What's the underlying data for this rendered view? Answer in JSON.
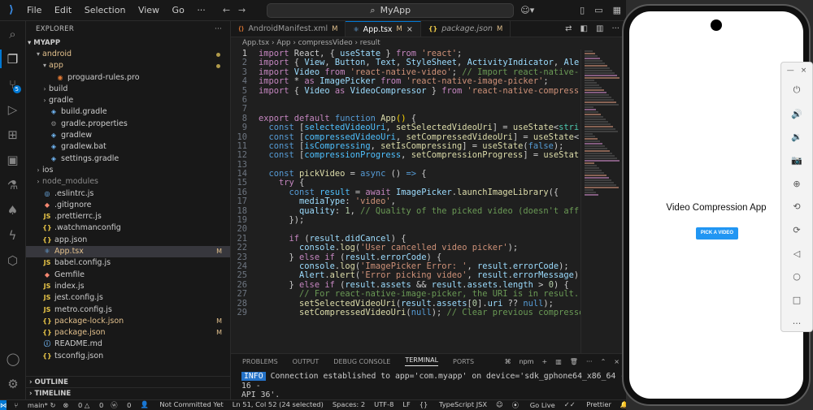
{
  "titlebar": {
    "menu": [
      "File",
      "Edit",
      "Selection",
      "View",
      "Go"
    ],
    "search": "MyApp"
  },
  "explorer": {
    "header": "EXPLORER",
    "project": "MYAPP",
    "items": [
      {
        "label": "android",
        "type": "folder",
        "open": true,
        "indent": 1,
        "color": "mod",
        "dot": true
      },
      {
        "label": "app",
        "type": "folder",
        "open": true,
        "indent": 2,
        "color": "mod",
        "dot": true
      },
      {
        "label": "proguard-rules.pro",
        "type": "file",
        "indent": 3,
        "color": "plain",
        "icon": "pro-file-icon"
      },
      {
        "label": "build",
        "type": "folder",
        "open": false,
        "indent": 2,
        "color": "plain"
      },
      {
        "label": "gradle",
        "type": "folder",
        "open": false,
        "indent": 2,
        "color": "plain"
      },
      {
        "label": "build.gradle",
        "type": "file",
        "indent": 2,
        "color": "plain",
        "icon": "gradle-icon"
      },
      {
        "label": "gradle.properties",
        "type": "file",
        "indent": 2,
        "color": "plain",
        "icon": "gear-icon"
      },
      {
        "label": "gradlew",
        "type": "file",
        "indent": 2,
        "color": "plain",
        "icon": "gradle-icon"
      },
      {
        "label": "gradlew.bat",
        "type": "file",
        "indent": 2,
        "color": "plain",
        "icon": "gradle-icon"
      },
      {
        "label": "settings.gradle",
        "type": "file",
        "indent": 2,
        "color": "plain",
        "icon": "gradle-icon"
      },
      {
        "label": "ios",
        "type": "folder",
        "open": false,
        "indent": 1,
        "color": "plain"
      },
      {
        "label": "node_modules",
        "type": "folder",
        "open": false,
        "indent": 1,
        "color": "gray"
      },
      {
        "label": ".eslintrc.js",
        "type": "file",
        "indent": 1,
        "color": "plain",
        "icon": "eslint-icon"
      },
      {
        "label": ".gitignore",
        "type": "file",
        "indent": 1,
        "color": "plain",
        "icon": "git-icon"
      },
      {
        "label": ".prettierrc.js",
        "type": "file",
        "indent": 1,
        "color": "plain",
        "icon": "js-icon"
      },
      {
        "label": ".watchmanconfig",
        "type": "file",
        "indent": 1,
        "color": "plain",
        "icon": "json-icon"
      },
      {
        "label": "app.json",
        "type": "file",
        "indent": 1,
        "color": "plain",
        "icon": "json-icon"
      },
      {
        "label": "App.tsx",
        "type": "file",
        "indent": 1,
        "color": "mod",
        "icon": "react-icon",
        "status": "M",
        "selected": true
      },
      {
        "label": "babel.config.js",
        "type": "file",
        "indent": 1,
        "color": "plain",
        "icon": "js-icon"
      },
      {
        "label": "Gemfile",
        "type": "file",
        "indent": 1,
        "color": "plain",
        "icon": "ruby-icon"
      },
      {
        "label": "index.js",
        "type": "file",
        "indent": 1,
        "color": "plain",
        "icon": "js-icon"
      },
      {
        "label": "jest.config.js",
        "type": "file",
        "indent": 1,
        "color": "plain",
        "icon": "js-icon"
      },
      {
        "label": "metro.config.js",
        "type": "file",
        "indent": 1,
        "color": "plain",
        "icon": "js-icon"
      },
      {
        "label": "package-lock.json",
        "type": "file",
        "indent": 1,
        "color": "mod",
        "icon": "json-icon",
        "status": "M"
      },
      {
        "label": "package.json",
        "type": "file",
        "indent": 1,
        "color": "mod",
        "icon": "json-icon",
        "status": "M"
      },
      {
        "label": "README.md",
        "type": "file",
        "indent": 1,
        "color": "plain",
        "icon": "info-icon"
      },
      {
        "label": "tsconfig.json",
        "type": "file",
        "indent": 1,
        "color": "plain",
        "icon": "json-icon"
      }
    ],
    "outline": "OUTLINE",
    "timeline": "TIMELINE"
  },
  "tabs": [
    {
      "label": "AndroidManifest.xml",
      "status": "M",
      "active": false,
      "icon": "xml-icon"
    },
    {
      "label": "App.tsx",
      "status": "M",
      "active": true,
      "icon": "react-icon"
    },
    {
      "label": "package.json",
      "status": "M",
      "active": false,
      "icon": "json-icon"
    }
  ],
  "breadcrumb": "App.tsx  ›  App  ›  compressVideo  ›  result",
  "code": {
    "current_line": 1,
    "lines": [
      [
        [
          "kw",
          "import"
        ],
        [
          "txt",
          " React, { "
        ],
        [
          "id",
          "useState"
        ],
        [
          "txt",
          " } "
        ],
        [
          "kw",
          "from"
        ],
        [
          "str",
          " 'react'"
        ],
        [
          "txt",
          ";"
        ]
      ],
      [
        [
          "kw",
          "import"
        ],
        [
          "txt",
          " { "
        ],
        [
          "id",
          "View"
        ],
        [
          "txt",
          ", "
        ],
        [
          "id",
          "Button"
        ],
        [
          "txt",
          ", "
        ],
        [
          "id",
          "Text"
        ],
        [
          "txt",
          ", "
        ],
        [
          "id",
          "StyleSheet"
        ],
        [
          "txt",
          ", "
        ],
        [
          "id",
          "ActivityIndicator"
        ],
        [
          "txt",
          ", "
        ],
        [
          "id",
          "Ale"
        ]
      ],
      [
        [
          "kw",
          "import"
        ],
        [
          "id",
          " Video"
        ],
        [
          "kw",
          " from"
        ],
        [
          "str",
          " 'react-native-video'"
        ],
        [
          "txt",
          "; "
        ],
        [
          "cm",
          "// Import react-native-"
        ]
      ],
      [
        [
          "kw",
          "import"
        ],
        [
          "txt",
          " * "
        ],
        [
          "kw",
          "as"
        ],
        [
          "id",
          " ImagePicker"
        ],
        [
          "kw",
          " from"
        ],
        [
          "str",
          " 'react-native-image-picker'"
        ],
        [
          "txt",
          ";"
        ]
      ],
      [
        [
          "kw",
          "import"
        ],
        [
          "txt",
          " { "
        ],
        [
          "id",
          "Video"
        ],
        [
          "kw",
          " as"
        ],
        [
          "id",
          " VideoCompressor"
        ],
        [
          "txt",
          " } "
        ],
        [
          "kw",
          "from"
        ],
        [
          "str",
          " 'react-native-compress"
        ]
      ],
      [],
      [],
      [
        [
          "kw",
          "export default"
        ],
        [
          "kw2",
          " function"
        ],
        [
          "fn",
          " App"
        ],
        [
          "pn",
          "()"
        ],
        [
          "txt",
          " {"
        ]
      ],
      [
        [
          "txt",
          "  "
        ],
        [
          "kw2",
          "const"
        ],
        [
          "txt",
          " ["
        ],
        [
          "cst",
          "selectedVideoUri"
        ],
        [
          "txt",
          ", "
        ],
        [
          "fn",
          "setSelectedVideoUri"
        ],
        [
          "txt",
          "] = "
        ],
        [
          "fn",
          "useState"
        ],
        [
          "txt",
          "<"
        ],
        [
          "cls",
          "stri"
        ]
      ],
      [
        [
          "txt",
          "  "
        ],
        [
          "kw2",
          "const"
        ],
        [
          "txt",
          " ["
        ],
        [
          "cst",
          "compressedVideoUri"
        ],
        [
          "txt",
          ", "
        ],
        [
          "fn",
          "setCompressedVideoUri"
        ],
        [
          "txt",
          "] = "
        ],
        [
          "fn",
          "useState"
        ],
        [
          "txt",
          "<"
        ]
      ],
      [
        [
          "txt",
          "  "
        ],
        [
          "kw2",
          "const"
        ],
        [
          "txt",
          " ["
        ],
        [
          "cst",
          "isCompressing"
        ],
        [
          "txt",
          ", "
        ],
        [
          "fn",
          "setIsCompressing"
        ],
        [
          "txt",
          "] = "
        ],
        [
          "fn",
          "useState"
        ],
        [
          "txt",
          "("
        ],
        [
          "kw2",
          "false"
        ],
        [
          "txt",
          ");"
        ]
      ],
      [
        [
          "txt",
          "  "
        ],
        [
          "kw2",
          "const"
        ],
        [
          "txt",
          " ["
        ],
        [
          "cst",
          "compressionProgress"
        ],
        [
          "txt",
          ", "
        ],
        [
          "fn",
          "setCompressionProgress"
        ],
        [
          "txt",
          "] = "
        ],
        [
          "fn",
          "useStat"
        ]
      ],
      [],
      [
        [
          "txt",
          "  "
        ],
        [
          "kw2",
          "const"
        ],
        [
          "fn",
          " pickVideo"
        ],
        [
          "txt",
          " = "
        ],
        [
          "kw2",
          "async"
        ],
        [
          "txt",
          " () "
        ],
        [
          "kw2",
          "=>"
        ],
        [
          "txt",
          " {"
        ]
      ],
      [
        [
          "txt",
          "    "
        ],
        [
          "kw",
          "try"
        ],
        [
          "txt",
          " {"
        ]
      ],
      [
        [
          "txt",
          "      "
        ],
        [
          "kw2",
          "const"
        ],
        [
          "cst",
          " result"
        ],
        [
          "txt",
          " = "
        ],
        [
          "kw",
          "await"
        ],
        [
          "id",
          " ImagePicker"
        ],
        [
          "txt",
          "."
        ],
        [
          "fn",
          "launchImageLibrary"
        ],
        [
          "txt",
          "({"
        ]
      ],
      [
        [
          "txt",
          "        "
        ],
        [
          "id",
          "mediaType"
        ],
        [
          "txt",
          ": "
        ],
        [
          "str",
          "'video'"
        ],
        [
          "txt",
          ","
        ]
      ],
      [
        [
          "txt",
          "        "
        ],
        [
          "id",
          "quality"
        ],
        [
          "txt",
          ": "
        ],
        [
          "num",
          "1"
        ],
        [
          "txt",
          ", "
        ],
        [
          "cm",
          "// Quality of the picked video (doesn't aff"
        ]
      ],
      [
        [
          "txt",
          "      });"
        ]
      ],
      [],
      [
        [
          "txt",
          "      "
        ],
        [
          "kw",
          "if"
        ],
        [
          "txt",
          " ("
        ],
        [
          "id",
          "result"
        ],
        [
          "txt",
          "."
        ],
        [
          "id",
          "didCancel"
        ],
        [
          "txt",
          ") {"
        ]
      ],
      [
        [
          "txt",
          "        "
        ],
        [
          "id",
          "console"
        ],
        [
          "txt",
          "."
        ],
        [
          "fn",
          "log"
        ],
        [
          "txt",
          "("
        ],
        [
          "str",
          "'User cancelled video picker'"
        ],
        [
          "txt",
          ");"
        ]
      ],
      [
        [
          "txt",
          "      } "
        ],
        [
          "kw",
          "else if"
        ],
        [
          "txt",
          " ("
        ],
        [
          "id",
          "result"
        ],
        [
          "txt",
          "."
        ],
        [
          "id",
          "errorCode"
        ],
        [
          "txt",
          ") {"
        ]
      ],
      [
        [
          "txt",
          "        "
        ],
        [
          "id",
          "console"
        ],
        [
          "txt",
          "."
        ],
        [
          "fn",
          "log"
        ],
        [
          "txt",
          "("
        ],
        [
          "str",
          "'ImagePicker Error: '"
        ],
        [
          "txt",
          ", "
        ],
        [
          "id",
          "result"
        ],
        [
          "txt",
          "."
        ],
        [
          "id",
          "errorCode"
        ],
        [
          "txt",
          ");"
        ]
      ],
      [
        [
          "txt",
          "        "
        ],
        [
          "id",
          "Alert"
        ],
        [
          "txt",
          "."
        ],
        [
          "fn",
          "alert"
        ],
        [
          "txt",
          "("
        ],
        [
          "str",
          "'Error picking video'"
        ],
        [
          "txt",
          ", "
        ],
        [
          "id",
          "result"
        ],
        [
          "txt",
          "."
        ],
        [
          "id",
          "errorMessage"
        ],
        [
          "txt",
          ")"
        ]
      ],
      [
        [
          "txt",
          "      } "
        ],
        [
          "kw",
          "else if"
        ],
        [
          "txt",
          " ("
        ],
        [
          "id",
          "result"
        ],
        [
          "txt",
          "."
        ],
        [
          "id",
          "assets"
        ],
        [
          "txt",
          " && "
        ],
        [
          "id",
          "result"
        ],
        [
          "txt",
          "."
        ],
        [
          "id",
          "assets"
        ],
        [
          "txt",
          "."
        ],
        [
          "id",
          "length"
        ],
        [
          "txt",
          " > "
        ],
        [
          "num",
          "0"
        ],
        [
          "txt",
          ") {"
        ]
      ],
      [
        [
          "txt",
          "        "
        ],
        [
          "cm",
          "// For react-native-image-picker, the URI is in result."
        ]
      ],
      [
        [
          "txt",
          "        "
        ],
        [
          "fn",
          "setSelectedVideoUri"
        ],
        [
          "txt",
          "("
        ],
        [
          "id",
          "result"
        ],
        [
          "txt",
          "."
        ],
        [
          "id",
          "assets"
        ],
        [
          "txt",
          "["
        ],
        [
          "num",
          "0"
        ],
        [
          "txt",
          "]."
        ],
        [
          "id",
          "uri"
        ],
        [
          "txt",
          " ?? "
        ],
        [
          "kw2",
          "null"
        ],
        [
          "txt",
          ");"
        ]
      ],
      [
        [
          "txt",
          "        "
        ],
        [
          "fn",
          "setCompressedVideoUri"
        ],
        [
          "txt",
          "("
        ],
        [
          "kw2",
          "null"
        ],
        [
          "txt",
          "); "
        ],
        [
          "cm",
          "// Clear previous compressed"
        ]
      ]
    ]
  },
  "panel": {
    "tabs": [
      "PROBLEMS",
      "OUTPUT",
      "DEBUG CONSOLE",
      "TERMINAL",
      "PORTS"
    ],
    "active_tab": "TERMINAL",
    "shell": "npm",
    "terminal_badge": "INFO",
    "terminal_line1": "Connection established to app='com.myapp' on device='sdk_gphone64_x86_64 - 16 -",
    "terminal_line2": "API 36'."
  },
  "status": {
    "branch": "main*",
    "errors": "0",
    "warnings": "0",
    "ports": "0",
    "commit": "Not Committed Yet",
    "position": "Ln 51, Col 52 (24 selected)",
    "spaces": "Spaces: 2",
    "encoding": "UTF-8",
    "eol": "LF",
    "language": "TypeScript JSX",
    "golive": "Go Live",
    "prettier": "Prettier"
  },
  "phone": {
    "title": "Video Compression App",
    "button": "PICK A VIDEO",
    "accent": "#2196F3"
  },
  "emulator_tools": [
    "power-icon",
    "volume-up-icon",
    "volume-down-icon",
    "camera-icon",
    "zoom-icon",
    "rotate-left-icon",
    "rotate-right-icon",
    "back-icon",
    "home-icon",
    "overview-icon",
    "more-icon"
  ]
}
